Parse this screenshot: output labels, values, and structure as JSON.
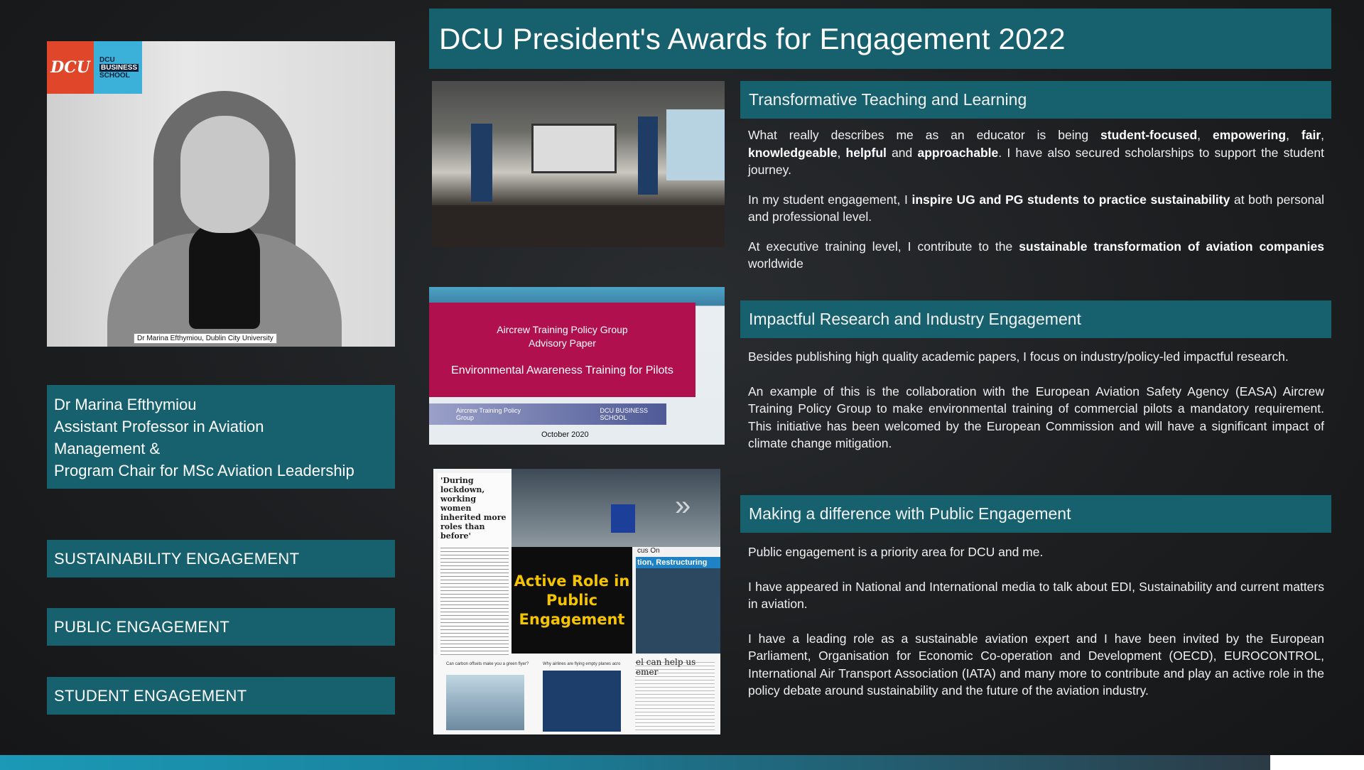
{
  "title": "DCU President's Awards for Engagement 2022",
  "left": {
    "logo": {
      "dcu": "DCU",
      "school_line1": "DCU",
      "school_line2": "BUSINESS",
      "school_line3": "SCHOOL"
    },
    "photo_caption": "Dr Marina Efthymiou, Dublin City University",
    "name_lines": [
      "Dr Marina Efthymiou",
      "Assistant Professor in Aviation",
      "Management &",
      "Program Chair for MSc Aviation Leadership"
    ],
    "tags": [
      "SUSTAINABILITY ENGAGEMENT",
      "PUBLIC ENGAGEMENT",
      "STUDENT ENGAGEMENT"
    ]
  },
  "paper": {
    "line1": "Aircrew Training Policy Group",
    "line2": "Advisory Paper",
    "line3": "Environmental Awareness Training for Pilots",
    "strip_left": "Aircrew Training Policy Group",
    "strip_right": "DCU BUSINESS SCHOOL",
    "date": "October 2020"
  },
  "collage": {
    "headline": "'During lockdown, working women inherited more roles than before'",
    "black_box_lines": [
      "Active Role in",
      "Public",
      "Engagement"
    ],
    "focus_label": "cus On",
    "restructuring": "tion, Restructuring",
    "bottom_caption1": "Can carbon offsets make you a green flyer?",
    "bottom_caption2": "Why airlines are flying empty planes acro",
    "bottom_caption3": "el can help us emer"
  },
  "sections": [
    {
      "heading": "Transformative Teaching and Learning",
      "paragraphs": [
        [
          {
            "t": "What really describes me as an educator is being "
          },
          {
            "t": "student-focused",
            "b": true
          },
          {
            "t": ", "
          },
          {
            "t": "empowering",
            "b": true
          },
          {
            "t": ", "
          },
          {
            "t": "fair",
            "b": true
          },
          {
            "t": ", "
          },
          {
            "t": "knowledgeable",
            "b": true
          },
          {
            "t": ", "
          },
          {
            "t": "helpful",
            "b": true
          },
          {
            "t": " and "
          },
          {
            "t": "approachable",
            "b": true
          },
          {
            "t": ".  I have also secured scholarships to support the student journey."
          }
        ],
        [
          {
            "t": "In my student engagement, I "
          },
          {
            "t": "inspire UG and PG students to practice sustainability",
            "b": true
          },
          {
            "t": " at both personal and professional level."
          }
        ],
        [
          {
            "t": "At executive training level, I contribute to the "
          },
          {
            "t": "sustainable transformation of aviation companies",
            "b": true
          },
          {
            "t": " worldwide"
          }
        ]
      ]
    },
    {
      "heading": "Impactful Research and Industry Engagement",
      "paragraphs": [
        [
          {
            "t": "Besides publishing high quality academic papers, I focus on industry/policy-led impactful research."
          }
        ],
        [
          {
            "t": "An example of this is the collaboration with the European Aviation Safety Agency (EASA) Aircrew Training Policy Group to make environmental training of commercial pilots a mandatory requirement. This initiative has been welcomed by the European Commission and will have a significant impact of climate change mitigation."
          }
        ]
      ]
    },
    {
      "heading": "Making a difference with Public Engagement",
      "paragraphs": [
        [
          {
            "t": "Public engagement is a priority area for DCU and me."
          }
        ],
        [
          {
            "t": "I have appeared in National and International media to talk about EDI, Sustainability and current matters in aviation."
          }
        ],
        [
          {
            "t": "I have a leading role as a sustainable aviation expert and I have been invited by the European Parliament, Organisation for Economic Co-operation and Development (OECD), EUROCONTROL, International Air Transport Association (IATA) and many more to contribute and play an active role in the policy debate around sustainability and the future of the aviation industry."
          }
        ]
      ]
    }
  ],
  "colors": {
    "teal": "#17606e",
    "background": "#1c1e20",
    "crimson": "#b0104d",
    "highlight_yellow": "#f5c400"
  }
}
